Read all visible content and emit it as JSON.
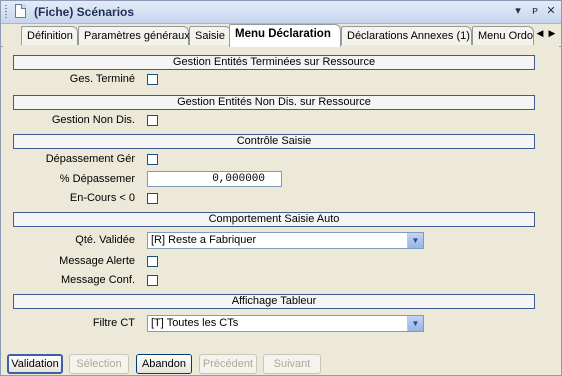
{
  "window": {
    "title": "(Fiche) Scénarios",
    "controls": {
      "dropdown": "▾",
      "pin": "ᴘ",
      "close": "✕"
    }
  },
  "tabs": [
    {
      "label": "Définition"
    },
    {
      "label": "Paramètres généraux"
    },
    {
      "label": "Saisie"
    },
    {
      "label": "Menu Déclaration",
      "active": true
    },
    {
      "label": "Déclarations Annexes (1)"
    },
    {
      "label": "Menu Ordo"
    }
  ],
  "tab_scroll": {
    "left": "◀",
    "right": "▶"
  },
  "sections": {
    "s1": "Gestion Entités Terminées sur Ressource",
    "s2": "Gestion Entités Non Dis. sur Ressource",
    "s3": "Contrôle Saisie",
    "s4": "Comportement Saisie Auto",
    "s5": "Affichage Tableur"
  },
  "fields": {
    "ges_termine": {
      "label": "Ges. Terminé",
      "checked": false
    },
    "gestion_non_dis": {
      "label": "Gestion Non Dis.",
      "checked": false
    },
    "depassement_ger": {
      "label": "Dépassement Gér",
      "checked": false
    },
    "pct_depassement": {
      "label": "% Dépassemer",
      "value": "0,000000"
    },
    "en_cours": {
      "label": "En-Cours < 0",
      "checked": false
    },
    "qte_validee": {
      "label": "Qté. Validée",
      "value": "[R] Reste a Fabriquer"
    },
    "message_alerte": {
      "label": "Message Alerte",
      "checked": false
    },
    "message_conf": {
      "label": "Message Conf.",
      "checked": false
    },
    "filtre_ct": {
      "label": "Filtre CT",
      "value": "[T] Toutes les CTs"
    }
  },
  "buttons": {
    "validation": "Validation",
    "selection": "Sélection",
    "abandon": "Abandon",
    "precedent": "Précédent",
    "suivant": "Suivant"
  },
  "colors": {
    "accent_border": "#3f5b91",
    "title_text": "#1f2f57"
  }
}
